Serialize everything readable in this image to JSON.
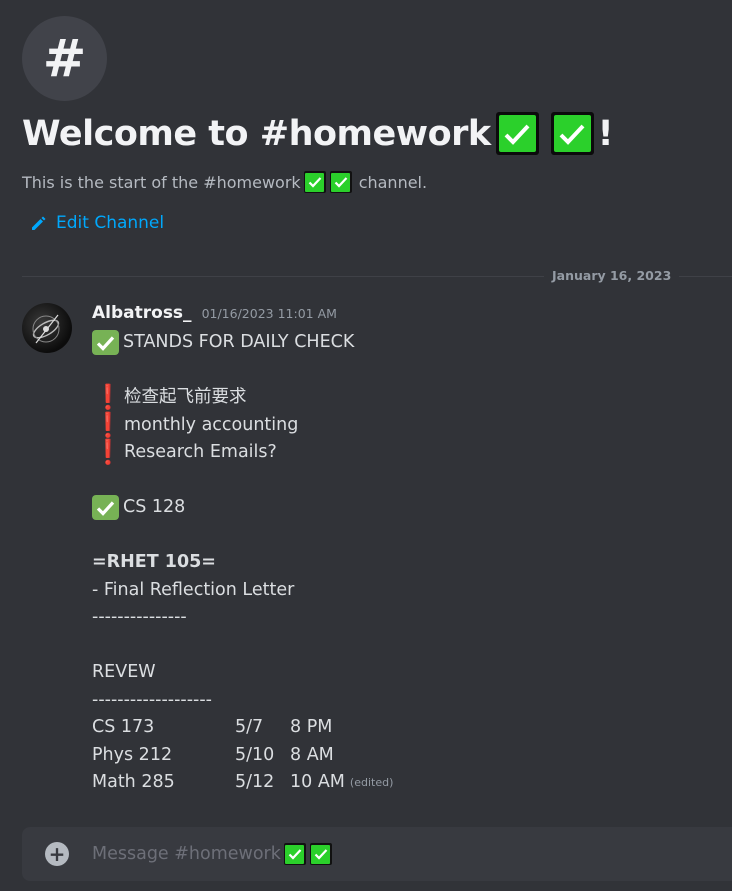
{
  "channel": {
    "hash_symbol": "#",
    "welcome_prefix": "Welcome to #homework",
    "welcome_suffix": "!",
    "subtitle_prefix": "This is the start of the #homework",
    "subtitle_suffix": "channel.",
    "edit_label": "Edit Channel"
  },
  "divider": {
    "date": "January 16, 2023"
  },
  "message": {
    "username": "Albatross_",
    "timestamp": "01/16/2023 11:01 AM",
    "line_daily_check": "STANDS FOR DAILY CHECK",
    "todo_1": "检查起飞前要求",
    "todo_2": "monthly accounting",
    "todo_3": "Research Emails?",
    "done_1": "CS 128",
    "rhet_title": "=RHET 105=",
    "rhet_item": "- Final Reflection Letter",
    "rhet_rule": "---------------",
    "review_title": "REVEW",
    "review_rule": "-------------------",
    "review_rows": [
      {
        "course": "CS 173",
        "date": "5/7",
        "time": "8 PM"
      },
      {
        "course": "Phys 212",
        "date": "5/10",
        "time": "8 AM"
      },
      {
        "course": "Math 285",
        "date": "5/12",
        "time": "10 AM"
      }
    ],
    "edited_label": "(edited)"
  },
  "composer": {
    "placeholder": "Message #homework"
  },
  "icons": {
    "check": "white-check-mark-icon",
    "exclamation": "red-exclamation-icon",
    "pencil": "pencil-icon",
    "plus": "plus-circle-icon"
  },
  "colors": {
    "background": "#313338",
    "link": "#00a8fc",
    "check_green": "#2bd02b",
    "emoji_check_green": "#77b255",
    "exclamation_red": "#dd2e44"
  }
}
